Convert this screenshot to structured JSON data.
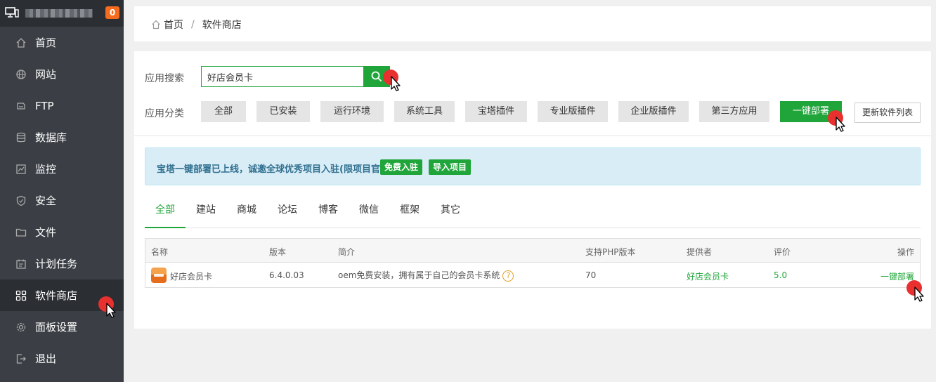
{
  "sidebar": {
    "badge": "0",
    "items": [
      {
        "label": "首页",
        "icon": "home-icon"
      },
      {
        "label": "网站",
        "icon": "globe-icon"
      },
      {
        "label": "FTP",
        "icon": "ftp-icon"
      },
      {
        "label": "数据库",
        "icon": "database-icon"
      },
      {
        "label": "监控",
        "icon": "monitor-chart-icon"
      },
      {
        "label": "安全",
        "icon": "shield-icon"
      },
      {
        "label": "文件",
        "icon": "folder-icon"
      },
      {
        "label": "计划任务",
        "icon": "calendar-icon"
      },
      {
        "label": "软件商店",
        "icon": "apps-grid-icon",
        "active": true
      },
      {
        "label": "面板设置",
        "icon": "gear-icon"
      },
      {
        "label": "退出",
        "icon": "logout-icon"
      }
    ]
  },
  "breadcrumb": {
    "home": "首页",
    "separator": "/",
    "current": "软件商店"
  },
  "search": {
    "label": "应用搜索",
    "value": "好店会员卡"
  },
  "categories": {
    "label": "应用分类",
    "items": [
      "全部",
      "已安装",
      "运行环境",
      "系统工具",
      "宝塔插件",
      "专业版插件",
      "企业版插件",
      "第三方应用",
      "一键部署"
    ],
    "refresh": "更新软件列表"
  },
  "notice": {
    "text": "宝塔一键部署已上线，诚邀全球优秀项目入驻(限项目官方)",
    "btn_join": "免费入驻",
    "btn_import": "导入项目"
  },
  "tabs": [
    "全部",
    "建站",
    "商城",
    "论坛",
    "博客",
    "微信",
    "框架",
    "其它"
  ],
  "table": {
    "headers": [
      "名称",
      "版本",
      "简介",
      "支持PHP版本",
      "提供者",
      "评价",
      "操作"
    ],
    "rows": [
      {
        "name": "好店会员卡",
        "version": "6.4.0.03",
        "desc": "oem免费安装，拥有属于自己的会员卡系统",
        "php": "70",
        "provider": "好店会员卡",
        "rating": "5.0",
        "action": "一键部署"
      }
    ]
  },
  "colors": {
    "accent": "#20a53a",
    "sidebar_bg": "#3b3f45",
    "badge": "#f56c1e",
    "notice_bg": "#d9edf7"
  }
}
